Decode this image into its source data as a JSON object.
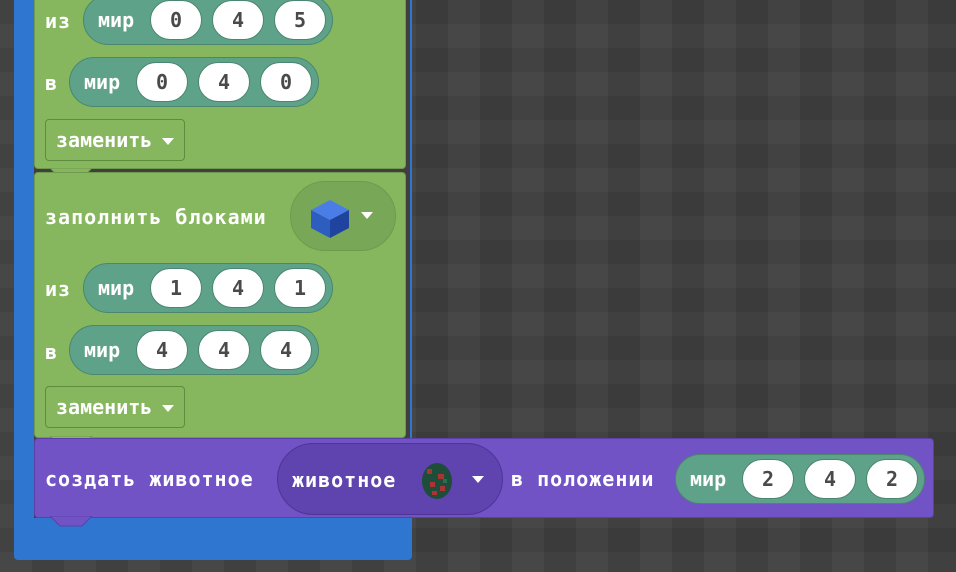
{
  "block1": {
    "from_label": "из",
    "from_world": {
      "label": "мир",
      "x": "0",
      "y": "4",
      "z": "5"
    },
    "to_label": "в",
    "to_world": {
      "label": "мир",
      "x": "0",
      "y": "4",
      "z": "0"
    },
    "mode": "заменить"
  },
  "block2": {
    "title": "заполнить блоками",
    "block_icon": "blue-cube-icon",
    "from_label": "из",
    "from_world": {
      "label": "мир",
      "x": "1",
      "y": "4",
      "z": "1"
    },
    "to_label": "в",
    "to_world": {
      "label": "мир",
      "x": "4",
      "y": "4",
      "z": "4"
    },
    "mode": "заменить"
  },
  "block3": {
    "title": "создать животное",
    "animal_label": "животное",
    "animal_icon": "spawn-egg-icon",
    "position_label": "в положении",
    "world": {
      "label": "мир",
      "x": "2",
      "y": "4",
      "z": "2"
    }
  },
  "colors": {
    "green": "#86b75e",
    "purple": "#7153c6",
    "blue": "#2f76d0",
    "world": "#5fa28a"
  }
}
